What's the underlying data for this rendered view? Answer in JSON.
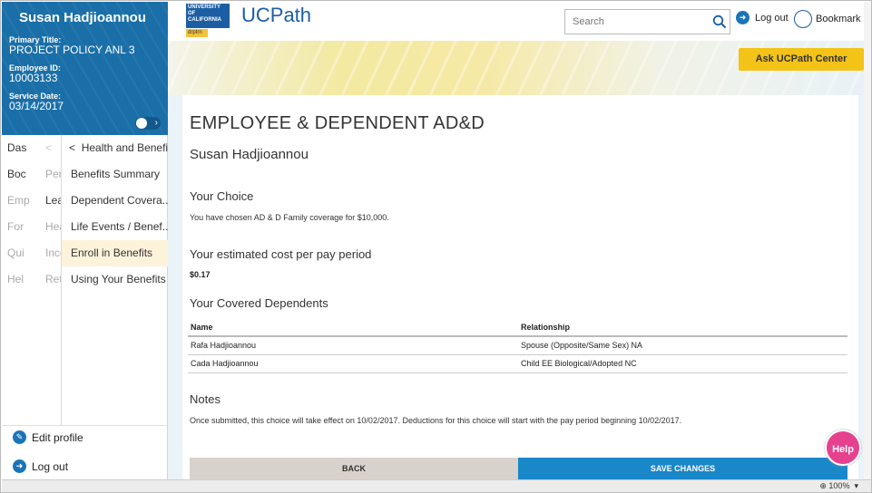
{
  "profile": {
    "name": "Susan Hadjioannou",
    "title_label": "Primary Title:",
    "title_value": "PROJECT POLICY ANL 3",
    "id_label": "Employee ID:",
    "id_value": "10003133",
    "service_label": "Service Date:",
    "service_value": "03/14/2017"
  },
  "nav": {
    "col1": [
      "Das",
      "Boc",
      "Emp",
      "For",
      "Qui",
      "Hel"
    ],
    "col2": [
      "<",
      "Per",
      "Lea",
      "Hea",
      "Inco",
      "Ret"
    ],
    "section_title": "Health and Benefits",
    "items": [
      "Benefits Summary",
      "Dependent Covera...",
      "Life Events / Benef...",
      "Enroll in Benefits",
      "Using Your Benefits"
    ]
  },
  "sidebar_bottom": {
    "edit_profile": "Edit profile",
    "log_out": "Log out"
  },
  "header": {
    "logo_text": "UNIVERSITY OF CALIFORNIA",
    "logo_tag": "drptrn",
    "brand": "UCPath",
    "search_placeholder": "Search",
    "log_out": "Log out",
    "bookmark": "Bookmark"
  },
  "banner": {
    "ask_button": "Ask UCPath Center"
  },
  "main": {
    "page_title": "EMPLOYEE & DEPENDENT AD&D",
    "employee_name": "Susan Hadjioannou",
    "choice_heading": "Your Choice",
    "choice_text": "You have chosen AD & D Family coverage for $10,000.",
    "cost_heading": "Your estimated cost per pay period",
    "cost_value": "$0.17",
    "dependents_heading": "Your Covered Dependents",
    "table_headers": [
      "Name",
      "Relationship"
    ],
    "dependents": [
      {
        "name": "Rafa Hadjioannou",
        "relationship": "Spouse (Opposite/Same Sex) NA"
      },
      {
        "name": "Cada Hadjioannou",
        "relationship": "Child EE Biological/Adopted NC"
      }
    ],
    "notes_heading": "Notes",
    "notes_text": "Once submitted, this choice will take effect on 10/02/2017. Deductions for this choice will start with the pay period beginning 10/02/2017.",
    "back_button": "BACK",
    "save_button": "SAVE CHANGES"
  },
  "help_button": "Help",
  "status_bar": {
    "zoom": "100%"
  },
  "colors": {
    "primary_blue": "#1a6fa8",
    "accent_yellow": "#f3c317",
    "save_blue": "#1a87c9",
    "help_pink": "#e6418f"
  }
}
